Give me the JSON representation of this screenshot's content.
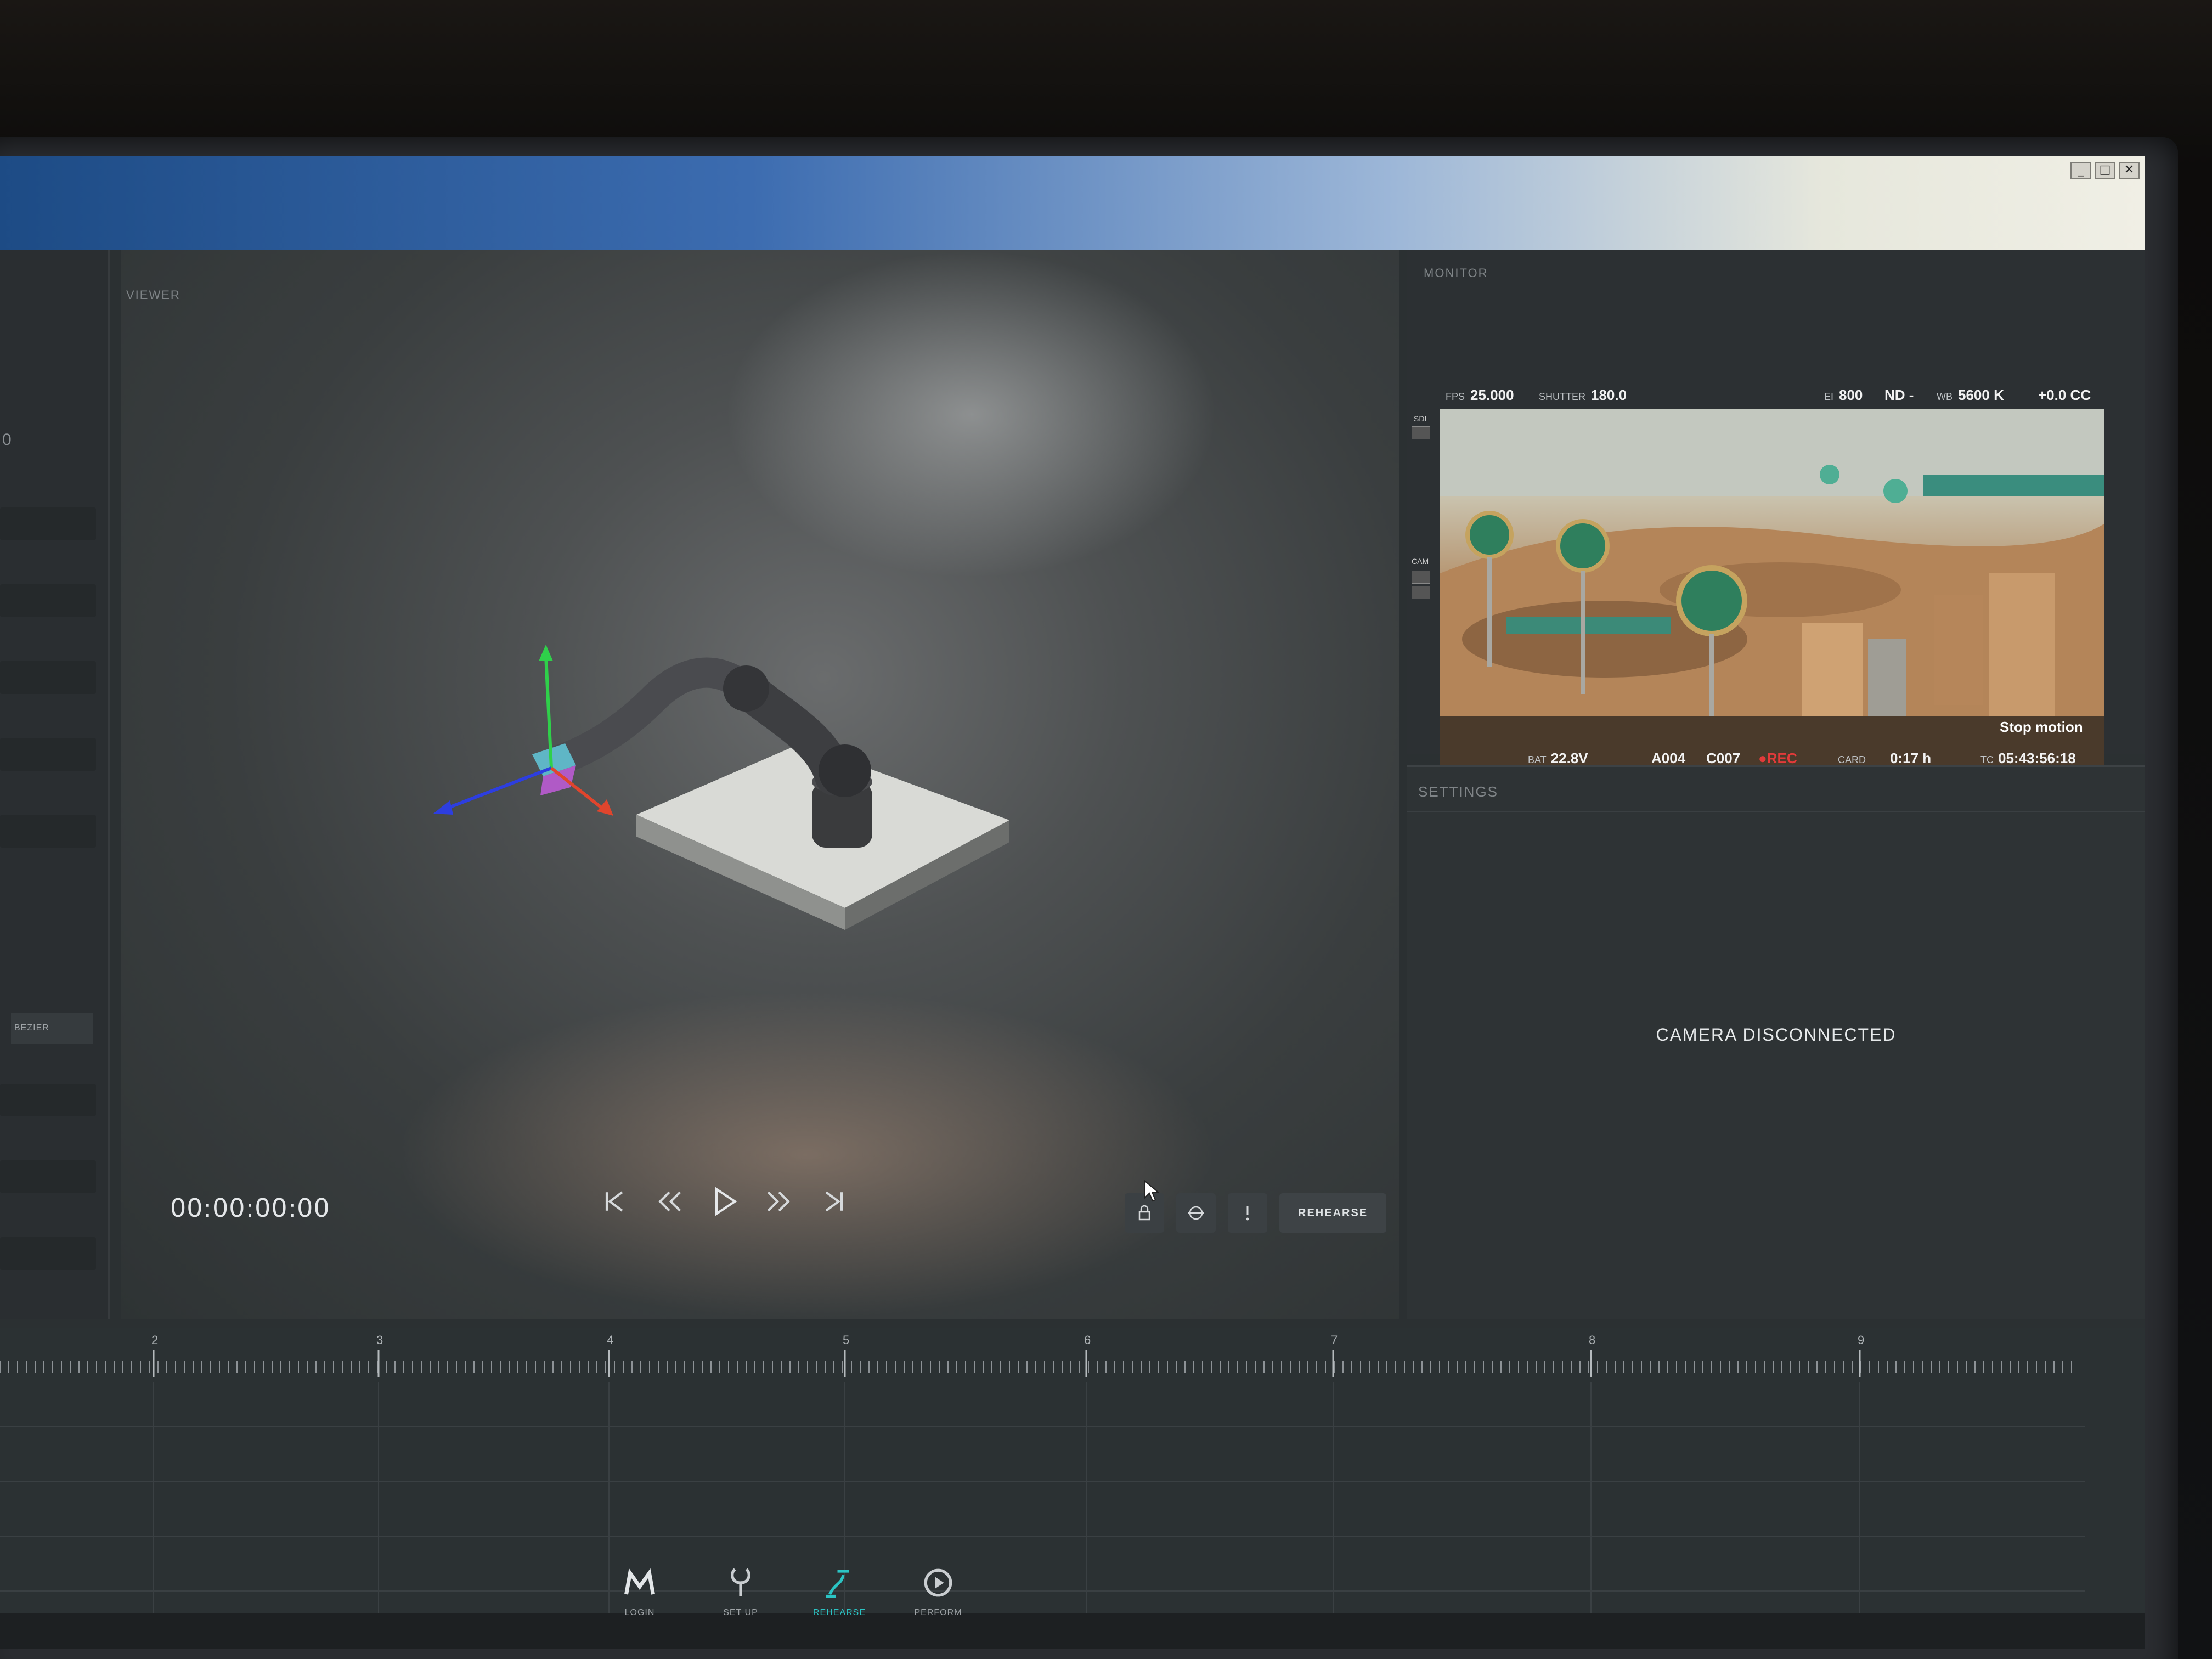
{
  "window": {
    "controls": [
      "_",
      "□",
      "✕"
    ]
  },
  "viewer": {
    "header": "VIEWER",
    "timecode": "00:00:00:00",
    "rehearse_label": "REHEARSE"
  },
  "sidebar": {
    "zero": "0",
    "bezier_label": "BEZIER"
  },
  "monitor": {
    "header": "MONITOR",
    "fps_label": "FPS",
    "fps": "25.000",
    "shutter_label": "SHUTTER",
    "shutter": "180.0",
    "ei_label": "EI",
    "ei": "800",
    "nd": "ND -",
    "wb_label": "WB",
    "wb": "5600 K",
    "cc": "+0.0 CC",
    "bat_label": "BAT",
    "bat": "22.8V",
    "clip_a": "A004",
    "clip_c": "C007",
    "rec": "●REC",
    "card_label": "CARD",
    "card": "0:17 h",
    "tc_label": "TC",
    "tc": "05:43:56:18",
    "stop_motion": "Stop motion",
    "side_sdi": "SDI",
    "side_cam": "CAM"
  },
  "settings": {
    "header": "SETTINGS",
    "status": "CAMERA DISCONNECTED"
  },
  "timeline": {
    "ticks": [
      "2",
      "3",
      "4",
      "5",
      "6",
      "7",
      "8",
      "9"
    ]
  },
  "nav": {
    "items": [
      {
        "label": "LOGIN",
        "icon": "m-logo-icon"
      },
      {
        "label": "SET UP",
        "icon": "wrench-icon"
      },
      {
        "label": "REHEARSE",
        "icon": "path-icon"
      },
      {
        "label": "PERFORM",
        "icon": "play-circle-icon"
      }
    ],
    "active_color": "#2bc4c4"
  }
}
